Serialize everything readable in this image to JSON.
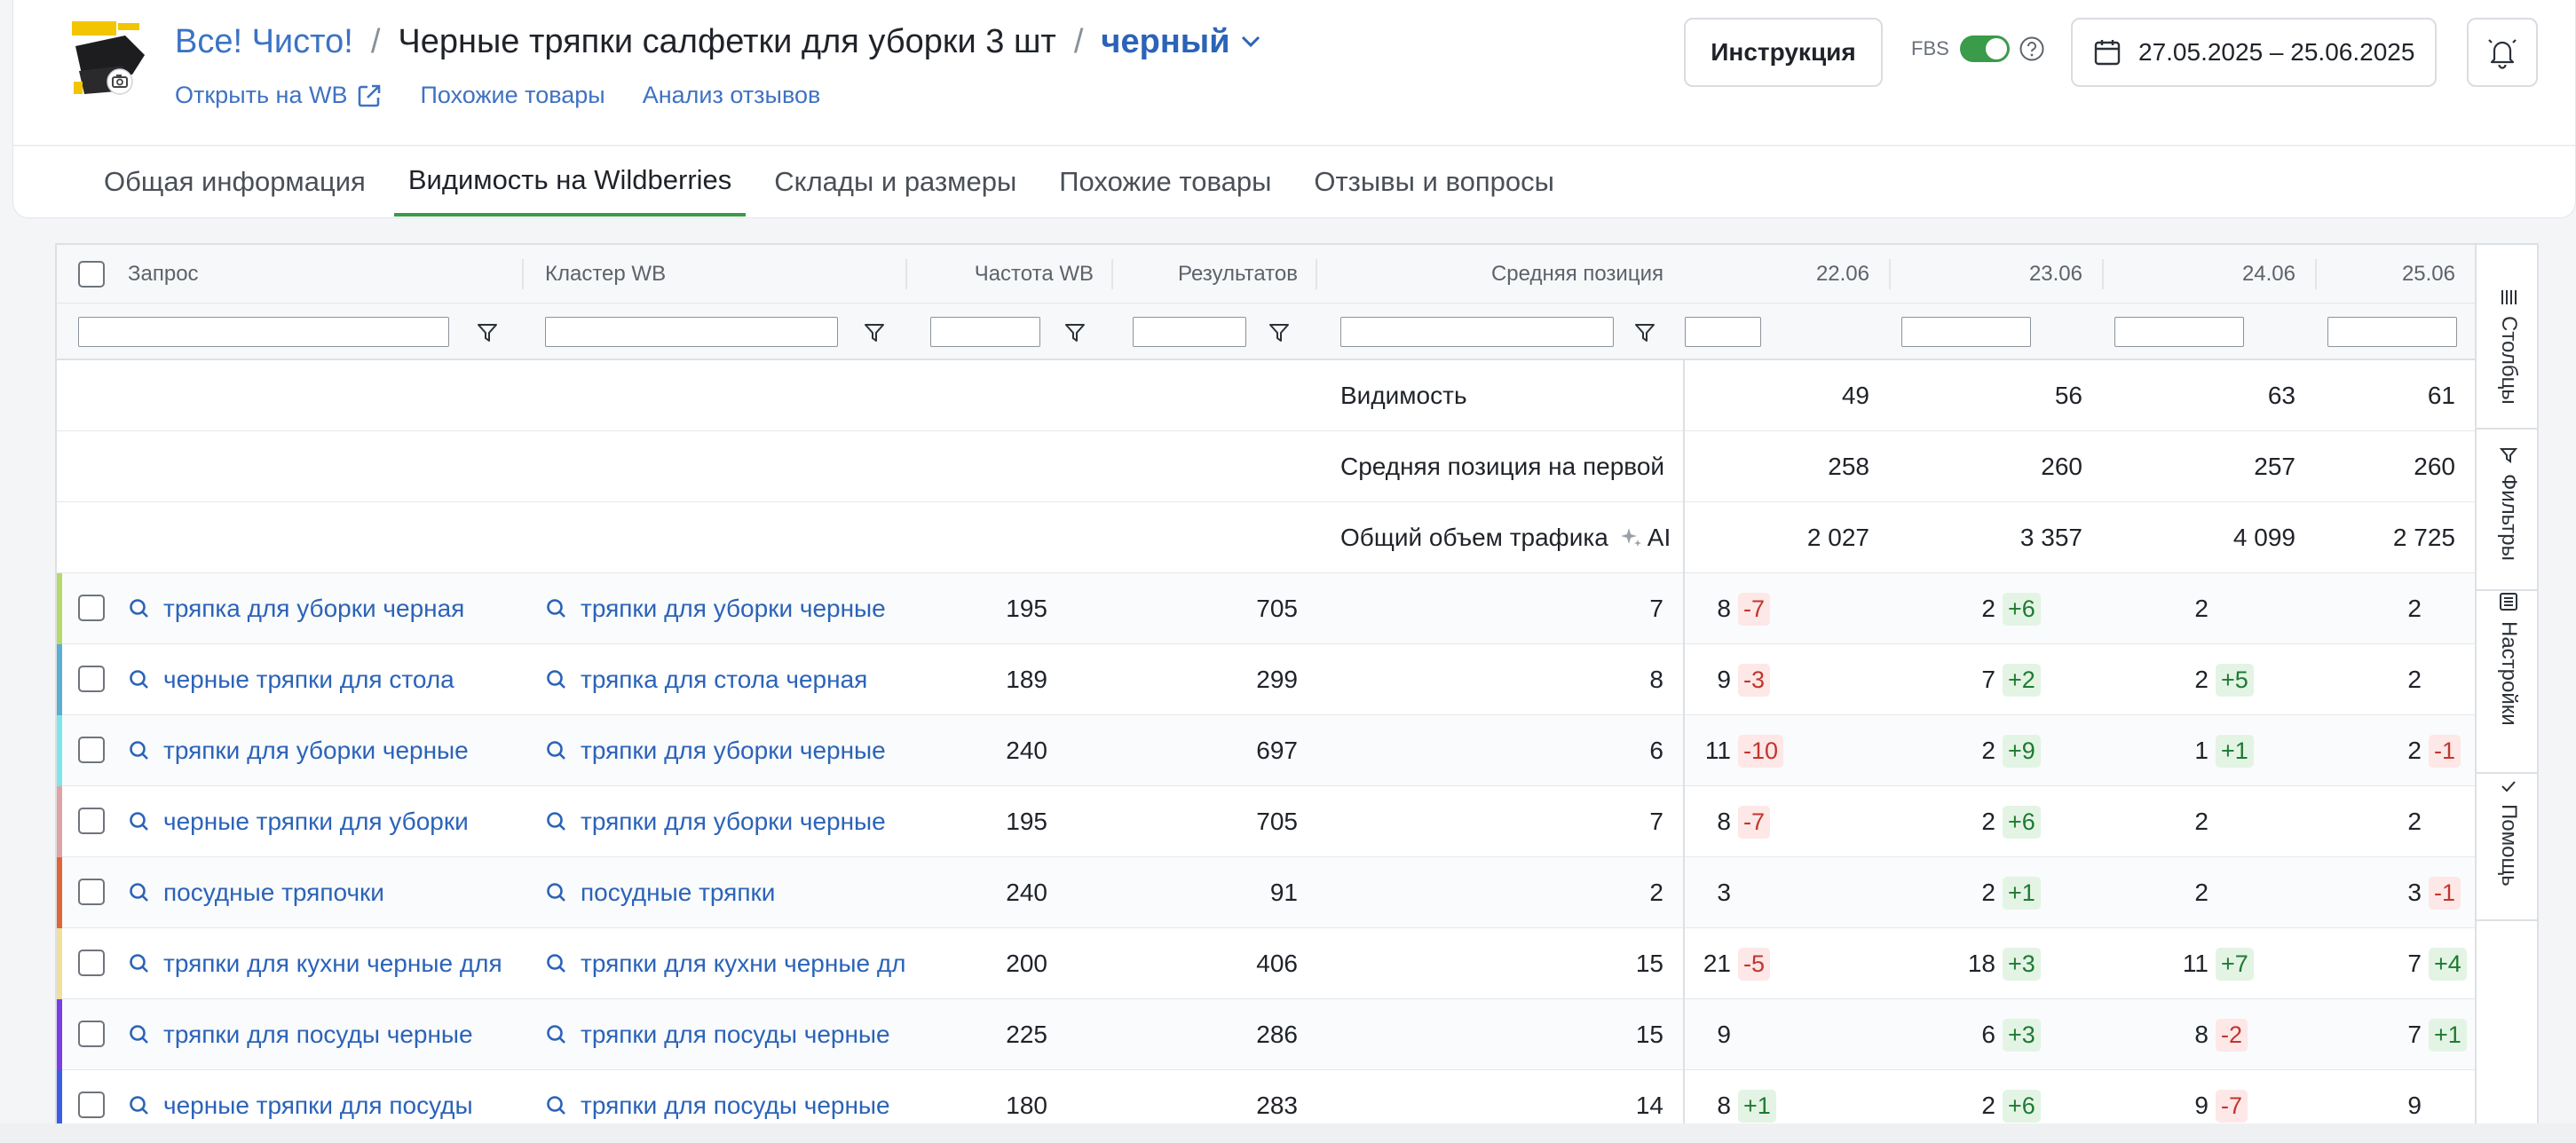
{
  "header": {
    "brand": "Все! Чисто!",
    "separator": "/",
    "title": "Черные тряпки салфетки для уборки 3 шт",
    "variant": "черный",
    "links": {
      "open_wb": "Открыть на WB",
      "similar": "Похожие товары",
      "reviews": "Анализ отзывов"
    },
    "instruction_label": "Инструкция",
    "fbs_label": "FBS",
    "date_range": "27.05.2025 – 25.06.2025",
    "accent_color": "#3a9b4a",
    "link_color": "#2b63b8"
  },
  "tabs": [
    {
      "label": "Общая информация",
      "active": false
    },
    {
      "label": "Видимость на Wildberries",
      "active": true
    },
    {
      "label": "Склады и размеры",
      "active": false
    },
    {
      "label": "Похожие товары",
      "active": false
    },
    {
      "label": "Отзывы и вопросы",
      "active": false
    }
  ],
  "table": {
    "columns": {
      "query": "Запрос",
      "cluster": "Кластер WB",
      "freq": "Частота WB",
      "results": "Результатов",
      "avg_pos": "Средняя позиция"
    },
    "dates": [
      "22.06",
      "23.06",
      "24.06",
      "25.06"
    ],
    "summary": [
      {
        "label": "Видимость",
        "values": [
          "49",
          "56",
          "63",
          "61"
        ]
      },
      {
        "label": "Средняя позиция на первой",
        "values": [
          "258",
          "260",
          "257",
          "260"
        ]
      },
      {
        "label": "Общий объем трафика",
        "ai": "AI",
        "values": [
          "2 027",
          "3 357",
          "4 099",
          "2 725"
        ]
      }
    ],
    "rows": [
      {
        "color": "#b5d96a",
        "query": "тряпка для уборки черная",
        "cluster": "тряпки для уборки черные",
        "freq": "195",
        "results": "705",
        "avg": "7",
        "days": [
          {
            "p": "8",
            "d": "-7"
          },
          {
            "p": "2",
            "d": "+6"
          },
          {
            "p": "2",
            "d": ""
          },
          {
            "p": "2",
            "d": ""
          }
        ]
      },
      {
        "color": "#5aaecf",
        "query": "черные тряпки для стола",
        "cluster": "тряпка для стола черная",
        "freq": "189",
        "results": "299",
        "avg": "8",
        "days": [
          {
            "p": "9",
            "d": "-3"
          },
          {
            "p": "7",
            "d": "+2"
          },
          {
            "p": "2",
            "d": "+5"
          },
          {
            "p": "2",
            "d": ""
          }
        ]
      },
      {
        "color": "#7ee6e8",
        "query": "тряпки для уборки черные",
        "cluster": "тряпки для уборки черные",
        "freq": "240",
        "results": "697",
        "avg": "6",
        "days": [
          {
            "p": "11",
            "d": "-10"
          },
          {
            "p": "2",
            "d": "+9"
          },
          {
            "p": "1",
            "d": "+1"
          },
          {
            "p": "2",
            "d": "-1"
          }
        ]
      },
      {
        "color": "#e0a3a3",
        "query": "черные тряпки для уборки",
        "cluster": "тряпки для уборки черные",
        "freq": "195",
        "results": "705",
        "avg": "7",
        "days": [
          {
            "p": "8",
            "d": "-7"
          },
          {
            "p": "2",
            "d": "+6"
          },
          {
            "p": "2",
            "d": ""
          },
          {
            "p": "2",
            "d": ""
          }
        ]
      },
      {
        "color": "#e0643a",
        "query": "посудные тряпочки",
        "cluster": "посудные тряпки",
        "freq": "240",
        "results": "91",
        "avg": "2",
        "days": [
          {
            "p": "3",
            "d": ""
          },
          {
            "p": "2",
            "d": "+1"
          },
          {
            "p": "2",
            "d": ""
          },
          {
            "p": "3",
            "d": "-1"
          }
        ]
      },
      {
        "color": "#efe09a",
        "query": "тряпки для кухни черные для",
        "cluster": "тряпки для кухни черные для",
        "freq": "200",
        "results": "406",
        "avg": "15",
        "days": [
          {
            "p": "21",
            "d": "-5"
          },
          {
            "p": "18",
            "d": "+3"
          },
          {
            "p": "11",
            "d": "+7"
          },
          {
            "p": "7",
            "d": "+4"
          }
        ]
      },
      {
        "color": "#7a3de6",
        "query": "тряпки для посуды черные",
        "cluster": "тряпки для посуды черные",
        "freq": "225",
        "results": "286",
        "avg": "15",
        "days": [
          {
            "p": "9",
            "d": ""
          },
          {
            "p": "6",
            "d": "+3"
          },
          {
            "p": "8",
            "d": "-2"
          },
          {
            "p": "7",
            "d": "+1"
          }
        ]
      },
      {
        "color": "#3b5de6",
        "query": "черные тряпки для посуды",
        "cluster": "тряпки для посуды черные",
        "freq": "180",
        "results": "283",
        "avg": "14",
        "days": [
          {
            "p": "8",
            "d": "+1"
          },
          {
            "p": "2",
            "d": "+6"
          },
          {
            "p": "9",
            "d": "-7"
          },
          {
            "p": "9",
            "d": ""
          }
        ]
      }
    ]
  },
  "side_panel": {
    "columns": "Столбцы",
    "filters": "Фильтры",
    "settings": "Настройки",
    "help": "Помощь"
  }
}
